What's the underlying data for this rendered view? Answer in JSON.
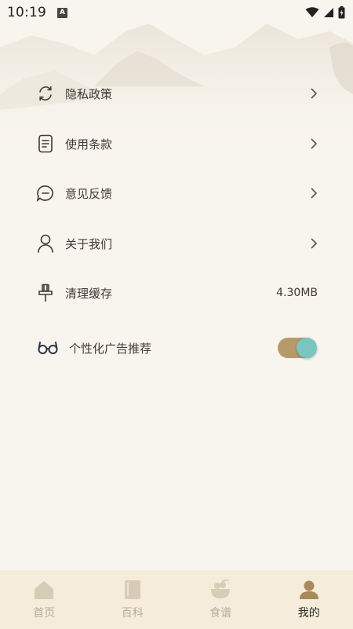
{
  "status_bar": {
    "time": "10:19",
    "notification_badge": "A"
  },
  "menu": {
    "items": [
      {
        "label": "隐私政策",
        "icon": "sync-icon",
        "has_chevron": true
      },
      {
        "label": "使用条款",
        "icon": "document-icon",
        "has_chevron": true
      },
      {
        "label": "意见反馈",
        "icon": "chat-bubble-icon",
        "has_chevron": true
      },
      {
        "label": "关于我们",
        "icon": "person-icon",
        "has_chevron": true
      },
      {
        "label": "清理缓存",
        "icon": "broom-icon",
        "value": "4.30MB"
      },
      {
        "label": "个性化广告推荐",
        "icon": "glasses-icon",
        "toggle_on": true
      }
    ]
  },
  "tabbar": {
    "tabs": [
      {
        "label": "首页",
        "icon": "home-icon",
        "active": false
      },
      {
        "label": "百科",
        "icon": "book-icon",
        "active": false
      },
      {
        "label": "食谱",
        "icon": "bowl-icon",
        "active": false
      },
      {
        "label": "我的",
        "icon": "user-icon",
        "active": true
      }
    ]
  },
  "colors": {
    "background": "#f8f5ee",
    "toggle_track": "#b69b6a",
    "toggle_knob": "#79c5c0",
    "tabbar_bg": "#f5ecdb",
    "tab_inactive": "#b7ad9f",
    "tab_active": "#2b2722"
  }
}
